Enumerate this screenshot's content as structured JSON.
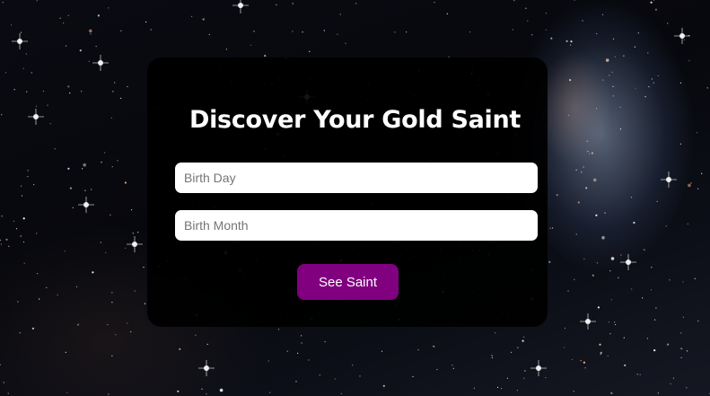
{
  "page": {
    "title": "Discover Your Gold Saint"
  },
  "form": {
    "birth_day": {
      "value": "",
      "placeholder": "Birth Day"
    },
    "birth_month": {
      "value": "",
      "placeholder": "Birth Month"
    },
    "submit_label": "See Saint"
  },
  "colors": {
    "button": "#800080",
    "card": "#000000",
    "title": "#ffffff"
  }
}
